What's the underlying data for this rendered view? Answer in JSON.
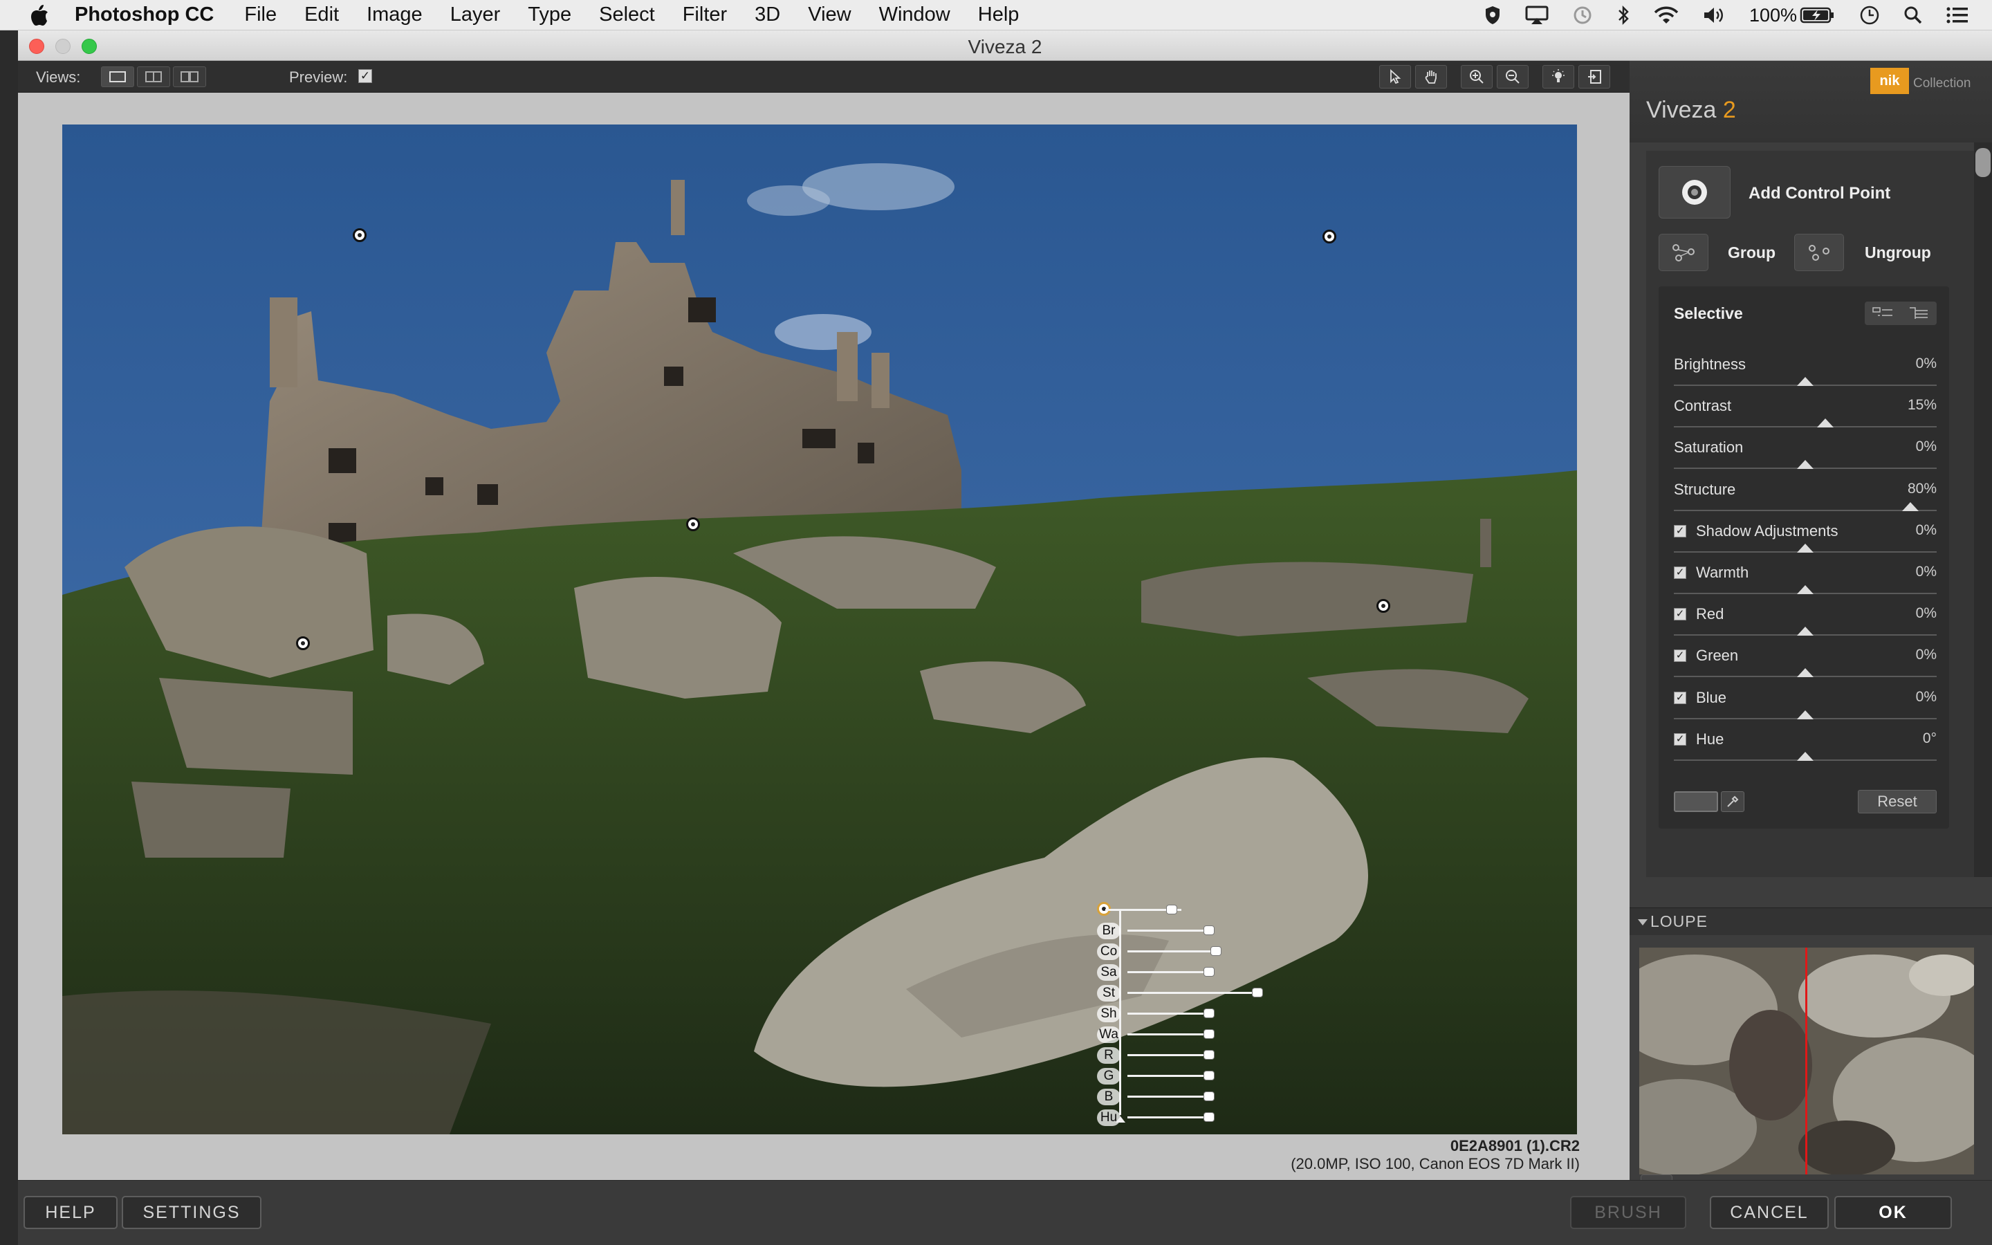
{
  "menubar": {
    "app_name": "Photoshop CC",
    "items": [
      "File",
      "Edit",
      "Image",
      "Layer",
      "Type",
      "Select",
      "Filter",
      "3D",
      "View",
      "Window",
      "Help"
    ],
    "battery": "100%"
  },
  "window": {
    "title": "Viveza 2"
  },
  "toolbar": {
    "views_label": "Views:",
    "preview_label": "Preview:",
    "preview_checked": true
  },
  "photo": {
    "filename": "0E2A8901 (1).CR2",
    "details": "(20.0MP, ISO 100, Canon EOS 7D Mark II)"
  },
  "control_point_labels": [
    "Br",
    "Co",
    "Sa",
    "St",
    "Sh",
    "Wa",
    "R",
    "G",
    "B",
    "Hu"
  ],
  "panel": {
    "brand": "nik",
    "brand_suffix": "Collection",
    "product": "Viveza",
    "version": "2",
    "add_control_point": "Add Control Point",
    "group": "Group",
    "ungroup": "Ungroup",
    "selective_title": "Selective",
    "sliders": [
      {
        "name": "Brightness",
        "value": "0%",
        "checkbox": false,
        "position": 0.5
      },
      {
        "name": "Contrast",
        "value": "15%",
        "checkbox": false,
        "position": 0.575
      },
      {
        "name": "Saturation",
        "value": "0%",
        "checkbox": false,
        "position": 0.5
      },
      {
        "name": "Structure",
        "value": "80%",
        "checkbox": false,
        "position": 0.9
      },
      {
        "name": "Shadow Adjustments",
        "value": "0%",
        "checkbox": true,
        "position": 0.5
      },
      {
        "name": "Warmth",
        "value": "0%",
        "checkbox": true,
        "position": 0.5
      },
      {
        "name": "Red",
        "value": "0%",
        "checkbox": true,
        "position": 0.5
      },
      {
        "name": "Green",
        "value": "0%",
        "checkbox": true,
        "position": 0.5
      },
      {
        "name": "Blue",
        "value": "0%",
        "checkbox": true,
        "position": 0.5
      },
      {
        "name": "Hue",
        "value": "0°",
        "checkbox": true,
        "position": 0.5
      }
    ],
    "reset": "Reset",
    "loupe": "LOUPE"
  },
  "bottom": {
    "help": "HELP",
    "settings": "SETTINGS",
    "brush": "BRUSH",
    "cancel": "CANCEL",
    "ok": "OK"
  }
}
